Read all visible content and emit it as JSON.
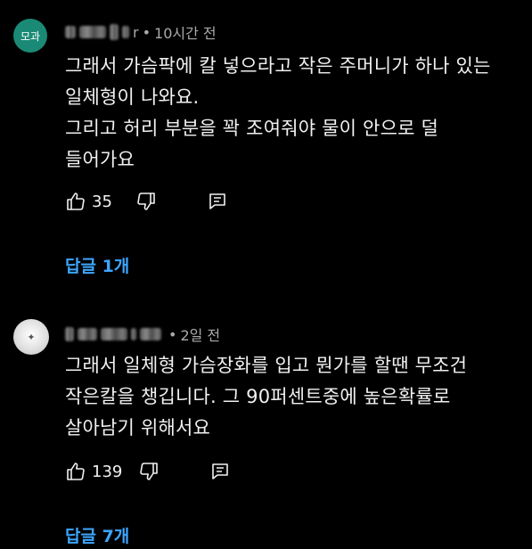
{
  "comments": [
    {
      "avatar_text": "모과",
      "author_tail": "r",
      "time": "10시간 전",
      "lines": [
        "그래서 가슴팍에 칼 넣으라고 작은 주머니가 하나 있는",
        "일체형이 나와요.",
        "그리고 허리 부분을 꽉 조여줘야 물이 안으로 덜",
        "들어가요"
      ],
      "likes": "35",
      "replies_label": "답글 1개"
    },
    {
      "avatar_text": "",
      "author_tail": "",
      "time": "2일 전",
      "lines": [
        "그래서 일체형 가슴장화를 입고 뭔가를 할땐 무조건",
        "작은칼을 챙깁니다. 그 90퍼센트중에 높은확률로",
        "살아남기 위해서요"
      ],
      "likes": "139",
      "replies_label": "답글 7개"
    }
  ],
  "separator": "•",
  "icons": {
    "like": "thumbs-up-icon",
    "dislike": "thumbs-down-icon",
    "reply": "reply-icon"
  },
  "colors": {
    "background": "#000000",
    "text": "#f1f1f1",
    "meta": "#aaaaaa",
    "link": "#3ea6ff",
    "avatar1": "#1a8a76"
  }
}
